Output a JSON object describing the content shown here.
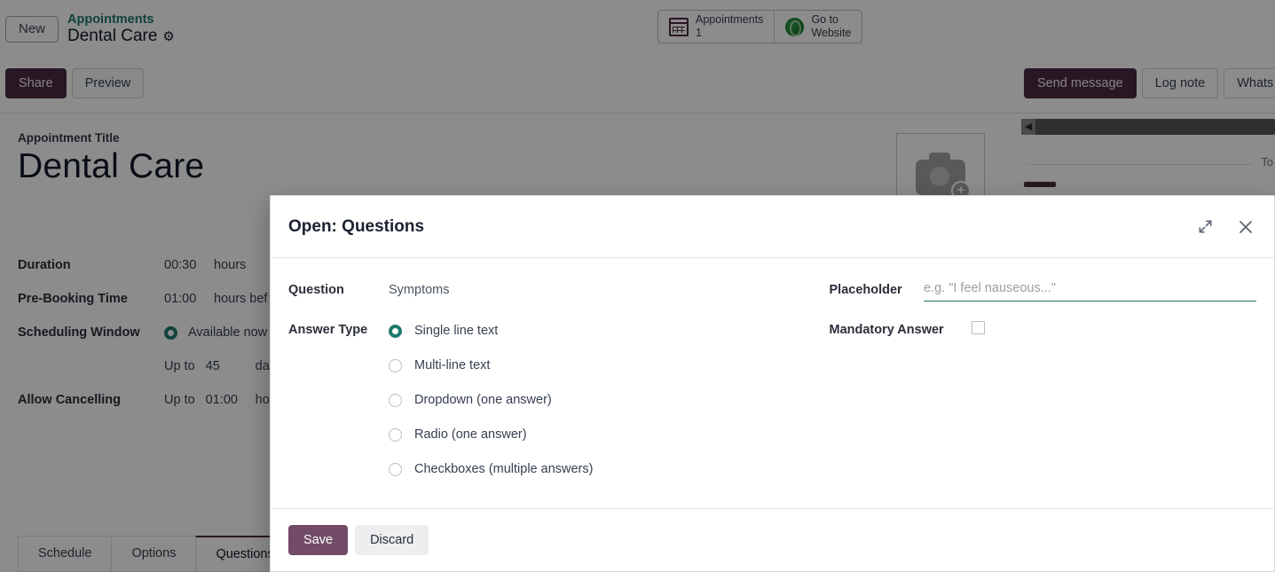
{
  "control_panel": {
    "new_button": "New",
    "breadcrumb_parent": "Appointments",
    "breadcrumb_current": "Dental Care",
    "gear_icon": "gear-icon",
    "stat_buttons": [
      {
        "icon": "calendar-icon",
        "label": "Appointments",
        "value": "1"
      },
      {
        "icon": "globe-icon",
        "label_line1": "Go to",
        "label_line2": "Website"
      }
    ]
  },
  "statusbar": {
    "left_buttons": [
      {
        "label": "Share",
        "style": "primary"
      },
      {
        "label": "Preview",
        "style": "light"
      }
    ],
    "right_buttons": [
      {
        "label": "Send message",
        "style": "primary"
      },
      {
        "label": "Log note",
        "style": "ghost"
      },
      {
        "label": "Whats",
        "style": "ghost"
      }
    ]
  },
  "form": {
    "title_label": "Appointment Title",
    "title_value": "Dental Care",
    "image_placeholder_icon": "camera-icon",
    "image_placeholder_badge": "+",
    "rows": [
      {
        "label": "Duration",
        "value": "00:30",
        "suffix": "hours"
      },
      {
        "label": "Pre-Booking Time",
        "value": "01:00",
        "suffix": "hours bef"
      },
      {
        "label": "Scheduling Window",
        "radio": "Available now",
        "radio_selected": true
      },
      {
        "label": "",
        "prefix": "Up to",
        "value": "45",
        "suffix": "da"
      },
      {
        "label": "Allow Cancelling",
        "prefix": "Up to",
        "value": "01:00",
        "suffix": "ho"
      }
    ],
    "tabs": [
      {
        "label": "Schedule",
        "active": false
      },
      {
        "label": "Options",
        "active": false
      },
      {
        "label": "Questions",
        "active": true
      }
    ]
  },
  "chatter": {
    "collapse_icon": "chevron-left-icon",
    "separator_label": "To"
  },
  "modal": {
    "title": "Open: Questions",
    "expand_icon": "expand-icon",
    "close_icon": "close-icon",
    "question_label": "Question",
    "question_value": "Symptoms",
    "answer_type_label": "Answer Type",
    "answer_types": [
      {
        "label": "Single line text",
        "selected": true
      },
      {
        "label": "Multi-line text",
        "selected": false
      },
      {
        "label": "Dropdown (one answer)",
        "selected": false
      },
      {
        "label": "Radio (one answer)",
        "selected": false
      },
      {
        "label": "Checkboxes (multiple answers)",
        "selected": false
      }
    ],
    "placeholder_label": "Placeholder",
    "placeholder_value": "",
    "placeholder_hint": "e.g. \"I feel nauseous...\"",
    "mandatory_label": "Mandatory Answer",
    "mandatory_checked": false,
    "save_label": "Save",
    "discard_label": "Discard"
  },
  "colors": {
    "brand_purple": "#714B67",
    "statusbar_purple": "#4B2A43",
    "accent_teal": "#1F7A6D",
    "link_teal": "#1F7A6D"
  }
}
